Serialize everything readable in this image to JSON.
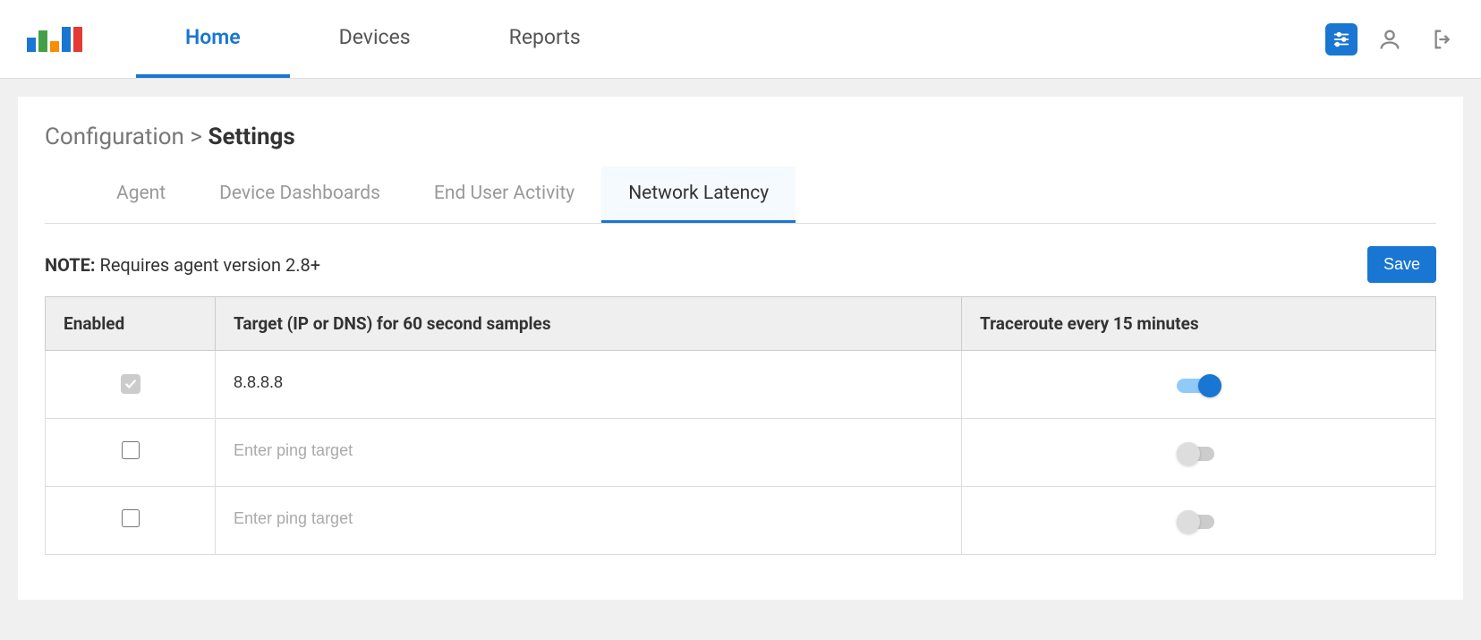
{
  "nav": {
    "items": [
      {
        "label": "Home",
        "active": true
      },
      {
        "label": "Devices",
        "active": false
      },
      {
        "label": "Reports",
        "active": false
      }
    ]
  },
  "breadcrumb": {
    "parent": "Configuration",
    "separator": ">",
    "current": "Settings"
  },
  "subtabs": [
    {
      "label": "Agent",
      "active": false
    },
    {
      "label": "Device Dashboards",
      "active": false
    },
    {
      "label": "End User Activity",
      "active": false
    },
    {
      "label": "Network Latency",
      "active": true
    }
  ],
  "note": {
    "prefix": "NOTE:",
    "text": "Requires agent version 2.8+"
  },
  "buttons": {
    "save": "Save"
  },
  "table": {
    "headers": {
      "enabled": "Enabled",
      "target": "Target (IP or DNS) for 60 second samples",
      "traceroute": "Traceroute every 15 minutes"
    },
    "placeholder": "Enter ping target",
    "rows": [
      {
        "enabled": true,
        "enabled_locked": true,
        "target": "8.8.8.8",
        "traceroute": true
      },
      {
        "enabled": false,
        "enabled_locked": false,
        "target": "",
        "traceroute": false
      },
      {
        "enabled": false,
        "enabled_locked": false,
        "target": "",
        "traceroute": false
      }
    ]
  },
  "icons": {
    "settings": "settings-sliders-icon",
    "user": "user-icon",
    "logout": "logout-icon"
  }
}
